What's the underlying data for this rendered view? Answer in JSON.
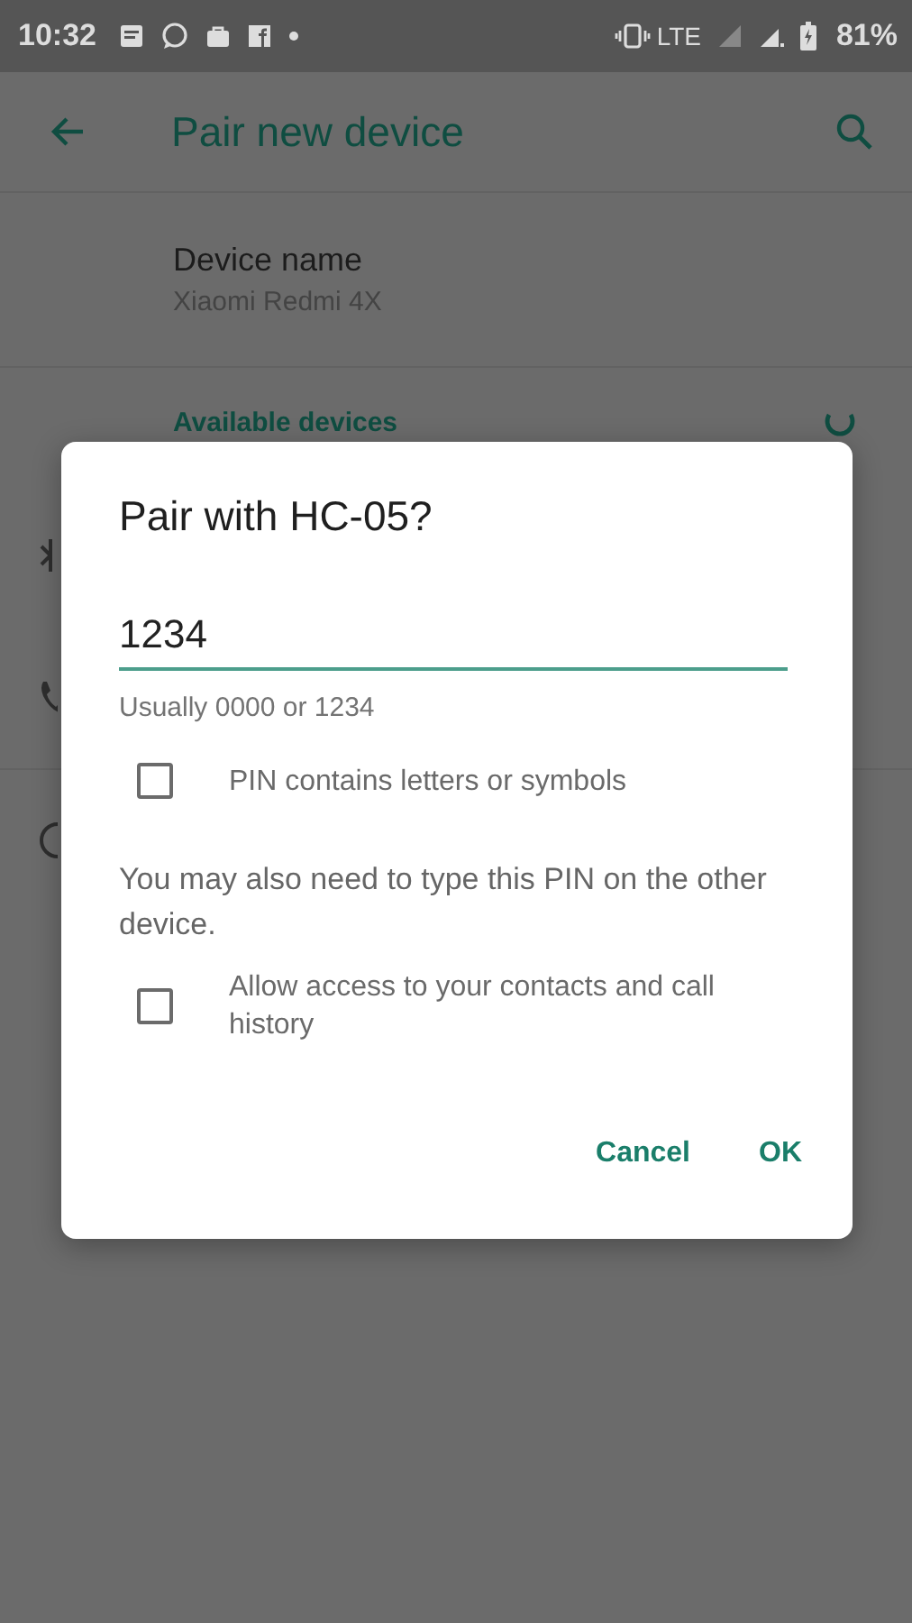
{
  "status_bar": {
    "time": "10:32",
    "network": "LTE",
    "battery": "81%"
  },
  "app_bar": {
    "title": "Pair new device"
  },
  "device_name": {
    "label": "Device name",
    "value": "Xiaomi Redmi 4X"
  },
  "available_devices": {
    "title": "Available devices"
  },
  "dialog": {
    "title": "Pair with HC-05?",
    "pin_field": {
      "value": "1234"
    },
    "helper": "Usually 0000 or 1234",
    "options": [
      {
        "label": "PIN contains letters or symbols",
        "checked": false
      }
    ],
    "message": "You may also need to type this PIN on the other device.",
    "access_option": {
      "label": "Allow access to your contacts and call history",
      "checked": false
    },
    "buttons": [
      "Cancel",
      "OK"
    ]
  }
}
